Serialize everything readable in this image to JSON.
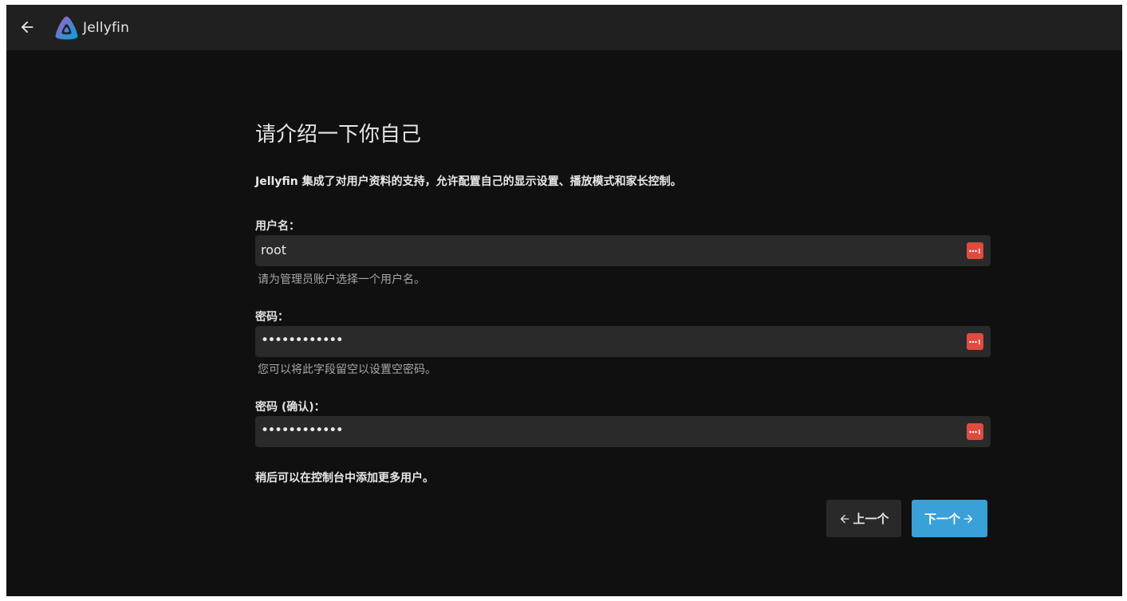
{
  "app": {
    "name": "Jellyfin"
  },
  "header": {
    "back_icon": "arrow-left-icon",
    "logo_icon": "jellyfin-logo-icon"
  },
  "page": {
    "title": "请介绍一下你自己",
    "intro": "Jellyfin 集成了对用户资料的支持，允许配置自己的显示设置、播放模式和家长控制。",
    "footnote": "稍后可以在控制台中添加更多用户。"
  },
  "form": {
    "username": {
      "label": "用户名：",
      "value": "root",
      "helper": "请为管理员账户选择一个用户名。"
    },
    "password": {
      "label": "密码：",
      "value": "••••••••••••",
      "helper": "您可以将此字段留空以设置空密码。"
    },
    "password_confirm": {
      "label": "密码 (确认)：",
      "value": "••••••••••••"
    },
    "password_manager_icon": "password-manager-icon"
  },
  "buttons": {
    "prev_label": "上一个",
    "next_label": "下一个"
  },
  "colors": {
    "accent": "#3aa0d8",
    "background": "#101010",
    "header": "#202020",
    "input": "#2a2a2a",
    "pw_icon": "#e04b3f"
  }
}
